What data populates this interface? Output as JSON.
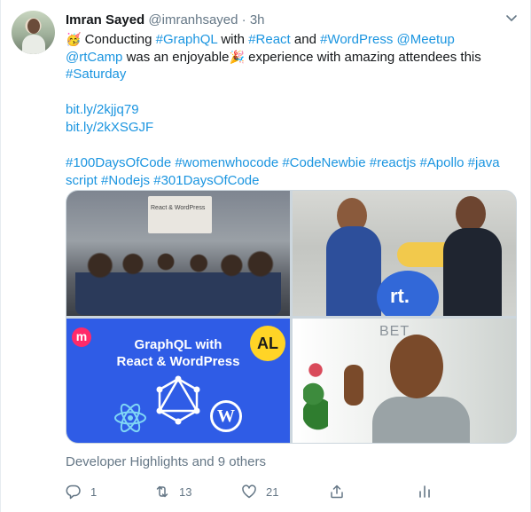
{
  "tweet": {
    "author": {
      "name": "Imran Sayed",
      "handle": "@imranhsayed",
      "separator": "·",
      "time": "3h"
    },
    "more_icon": "chevron-down-icon",
    "body": {
      "line1": {
        "emoji1": "🥳",
        "t1": " Conducting ",
        "h1": "#GraphQL",
        "t2": " with ",
        "h2": "#React",
        "t3": " and ",
        "h3": "#WordPress",
        "t4": " ",
        "h4": "@Meetup"
      },
      "line2": {
        "m1": "@rtCamp",
        "t1": " was an enjoyable",
        "emoji2": "🎉",
        "t2": " experience with amazing attendees this"
      },
      "line3": {
        "h1": "#Saturday"
      },
      "links": [
        "bit.ly/2kjjq79",
        "bit.ly/2kXSGJF"
      ],
      "hashtags_line1": {
        "a": "#100DaysOfCode",
        "b": "#womenwhocode",
        "c": "#CodeNewbie",
        "d": "#reactjs",
        "e": "#Apollo",
        "f": "#java"
      },
      "hashtags_line2": {
        "a": "script",
        "b": "#Nodejs",
        "c": "#301DaysOfCode"
      }
    },
    "media": {
      "tile1": {
        "banner_text": "React & WordPress"
      },
      "tile3": {
        "title_line1": "GraphQL with",
        "title_line2": "React & WordPress",
        "meetup_mark": "m"
      },
      "tile4": {
        "wall_text": "BET"
      }
    },
    "likers_text": "Developer Highlights and 9 others",
    "actions": {
      "reply": {
        "icon": "reply-icon",
        "count": "1"
      },
      "retweet": {
        "icon": "retweet-icon",
        "count": "13"
      },
      "like": {
        "icon": "heart-icon",
        "count": "21"
      },
      "share": {
        "icon": "share-icon"
      },
      "analytics": {
        "icon": "analytics-icon"
      }
    },
    "colors": {
      "link": "#1b95e0",
      "secondary": "#657786",
      "text": "#14171a"
    }
  }
}
